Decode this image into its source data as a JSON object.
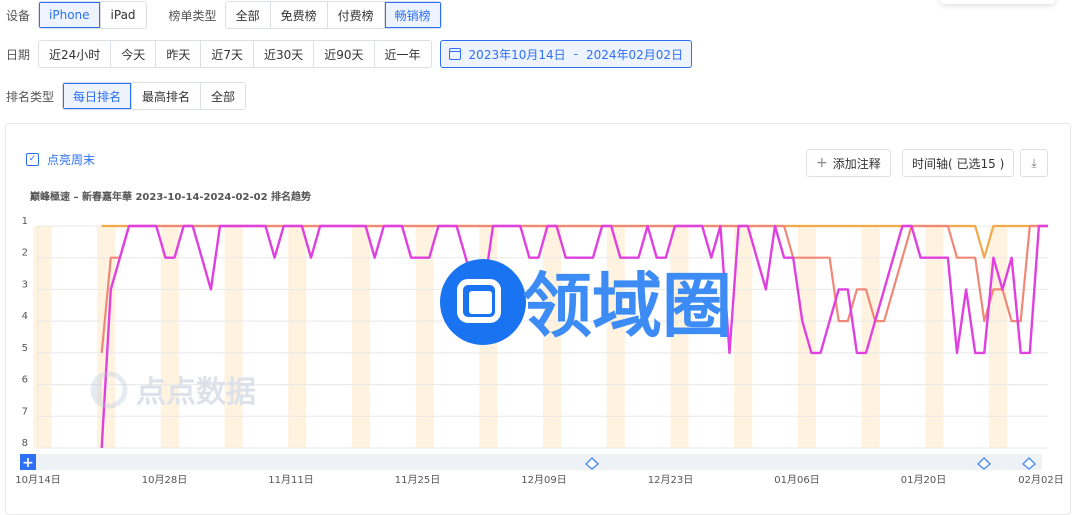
{
  "filters": {
    "device": {
      "label": "设备",
      "options": [
        "iPhone",
        "iPad"
      ],
      "active": 0
    },
    "chart_type": {
      "label": "榜单类型",
      "options": [
        "全部",
        "免费榜",
        "付费榜",
        "畅销榜"
      ],
      "active": 3
    },
    "date": {
      "label": "日期",
      "options": [
        "近24小时",
        "今天",
        "昨天",
        "近7天",
        "近30天",
        "近90天",
        "近一年"
      ],
      "range_start": "2023年10月14日",
      "range_sep": "-",
      "range_end": "2024年02月02日"
    },
    "rank_type": {
      "label": "排名类型",
      "options": [
        "每日排名",
        "最高排名",
        "全部"
      ],
      "active": 0
    }
  },
  "toolbar": {
    "highlight_weekend": "点亮周末",
    "add_note": "添加注释",
    "timeline": "时间轴( 已选15 )"
  },
  "watermark": {
    "brand": "领域圈",
    "source": "点点数据"
  },
  "colors": {
    "accent": "#2d6ff7",
    "magenta": "#e040e0",
    "salmon": "#f08878",
    "orange": "#f0a848",
    "weekend": "#fff3e0"
  },
  "chart_data": {
    "type": "line",
    "title": "巅峰極速 – 新春嘉年華 2023-10-14-2024-02-02 排名趋势",
    "x": [
      "2023-10-14",
      "2023-10-15",
      "2023-10-16",
      "2023-10-17",
      "2023-10-18",
      "2023-10-19",
      "2023-10-20",
      "2023-10-21",
      "2023-10-22",
      "2023-10-23",
      "2023-10-24",
      "2023-10-25",
      "2023-10-26",
      "2023-10-27",
      "2023-10-28",
      "2023-10-29",
      "2023-10-30",
      "2023-10-31",
      "2023-11-01",
      "2023-11-02",
      "2023-11-03",
      "2023-11-04",
      "2023-11-05",
      "2023-11-06",
      "2023-11-07",
      "2023-11-08",
      "2023-11-09",
      "2023-11-10",
      "2023-11-11",
      "2023-11-12",
      "2023-11-13",
      "2023-11-14",
      "2023-11-15",
      "2023-11-16",
      "2023-11-17",
      "2023-11-18",
      "2023-11-19",
      "2023-11-20",
      "2023-11-21",
      "2023-11-22",
      "2023-11-23",
      "2023-11-24",
      "2023-11-25",
      "2023-11-26",
      "2023-11-27",
      "2023-11-28",
      "2023-11-29",
      "2023-11-30",
      "2023-12-01",
      "2023-12-02",
      "2023-12-03",
      "2023-12-04",
      "2023-12-05",
      "2023-12-06",
      "2023-12-07",
      "2023-12-08",
      "2023-12-09",
      "2023-12-10",
      "2023-12-11",
      "2023-12-12",
      "2023-12-13",
      "2023-12-14",
      "2023-12-15",
      "2023-12-16",
      "2023-12-17",
      "2023-12-18",
      "2023-12-19",
      "2023-12-20",
      "2023-12-21",
      "2023-12-22",
      "2023-12-23",
      "2023-12-24",
      "2023-12-25",
      "2023-12-26",
      "2023-12-27",
      "2023-12-28",
      "2023-12-29",
      "2023-12-30",
      "2023-12-31",
      "2024-01-01",
      "2024-01-02",
      "2024-01-03",
      "2024-01-04",
      "2024-01-05",
      "2024-01-06",
      "2024-01-07",
      "2024-01-08",
      "2024-01-09",
      "2024-01-10",
      "2024-01-11",
      "2024-01-12",
      "2024-01-13",
      "2024-01-14",
      "2024-01-15",
      "2024-01-16",
      "2024-01-17",
      "2024-01-18",
      "2024-01-19",
      "2024-01-20",
      "2024-01-21",
      "2024-01-22",
      "2024-01-23",
      "2024-01-24",
      "2024-01-25",
      "2024-01-26",
      "2024-01-27",
      "2024-01-28",
      "2024-01-29",
      "2024-01-30",
      "2024-01-31",
      "2024-02-01",
      "2024-02-02"
    ],
    "x_tick_labels": [
      "10月14日",
      "10月28日",
      "11月11日",
      "11月25日",
      "12月09日",
      "12月23日",
      "01月06日",
      "01月20日",
      "02月02日"
    ],
    "y_tick_labels": [
      "1",
      "2",
      "3",
      "4",
      "5",
      "6",
      "7",
      "8"
    ],
    "ylim": [
      1,
      8
    ],
    "y_inverted": true,
    "grid": true,
    "series": [
      {
        "color": "#f0a848",
        "values": [
          null,
          null,
          null,
          null,
          null,
          null,
          null,
          1,
          1,
          1,
          1,
          1,
          1,
          1,
          1,
          1,
          1,
          1,
          1,
          1,
          1,
          1,
          1,
          1,
          1,
          1,
          1,
          1,
          1,
          1,
          1,
          1,
          1,
          1,
          1,
          1,
          1,
          1,
          1,
          1,
          1,
          1,
          1,
          1,
          1,
          1,
          1,
          1,
          1,
          1,
          1,
          1,
          1,
          1,
          1,
          1,
          1,
          1,
          1,
          1,
          1,
          1,
          1,
          1,
          1,
          1,
          1,
          1,
          1,
          1,
          1,
          1,
          1,
          1,
          1,
          1,
          1,
          1,
          1,
          1,
          1,
          1,
          1,
          1,
          1,
          1,
          1,
          1,
          1,
          1,
          1,
          1,
          1,
          1,
          1,
          1,
          1,
          1,
          1,
          1,
          1,
          1,
          1,
          1,
          2,
          1,
          1,
          1,
          1,
          1,
          1,
          1
        ]
      },
      {
        "color": "#f08878",
        "values": [
          null,
          null,
          null,
          null,
          null,
          null,
          null,
          5,
          2,
          2,
          1,
          1,
          1,
          1,
          1,
          1,
          1,
          1,
          1,
          1,
          1,
          1,
          1,
          1,
          1,
          1,
          1,
          1,
          1,
          1,
          1,
          1,
          1,
          1,
          1,
          1,
          1,
          1,
          1,
          1,
          1,
          1,
          1,
          1,
          1,
          1,
          1,
          1,
          1,
          1,
          1,
          1,
          1,
          1,
          1,
          1,
          1,
          1,
          1,
          1,
          1,
          1,
          1,
          1,
          1,
          1,
          1,
          1,
          1,
          1,
          1,
          1,
          1,
          1,
          1,
          1,
          1,
          1,
          1,
          1,
          1,
          1,
          1,
          2,
          2,
          2,
          2,
          2,
          4,
          4,
          3,
          3,
          4,
          4,
          3,
          2,
          1,
          1,
          1,
          1,
          1,
          2,
          2,
          2,
          4,
          3,
          3,
          4,
          4,
          1,
          1,
          1
        ]
      },
      {
        "color": "#e040e0",
        "values": [
          null,
          null,
          null,
          null,
          null,
          null,
          null,
          8,
          3,
          2,
          1,
          1,
          1,
          1,
          2,
          2,
          1,
          1,
          2,
          3,
          1,
          1,
          1,
          1,
          1,
          1,
          2,
          1,
          1,
          1,
          2,
          1,
          1,
          1,
          1,
          1,
          1,
          2,
          1,
          1,
          1,
          2,
          2,
          2,
          1,
          1,
          1,
          2,
          3,
          3,
          1,
          1,
          1,
          1,
          2,
          2,
          1,
          1,
          2,
          2,
          2,
          2,
          1,
          1,
          2,
          2,
          2,
          1,
          2,
          2,
          1,
          1,
          1,
          1,
          2,
          1,
          5,
          1,
          1,
          2,
          3,
          1,
          2,
          2,
          4,
          5,
          5,
          4,
          3,
          3,
          5,
          5,
          4,
          3,
          2,
          1,
          1,
          2,
          2,
          2,
          2,
          5,
          3,
          5,
          5,
          2,
          3,
          2,
          5,
          5,
          1,
          1
        ]
      }
    ]
  }
}
